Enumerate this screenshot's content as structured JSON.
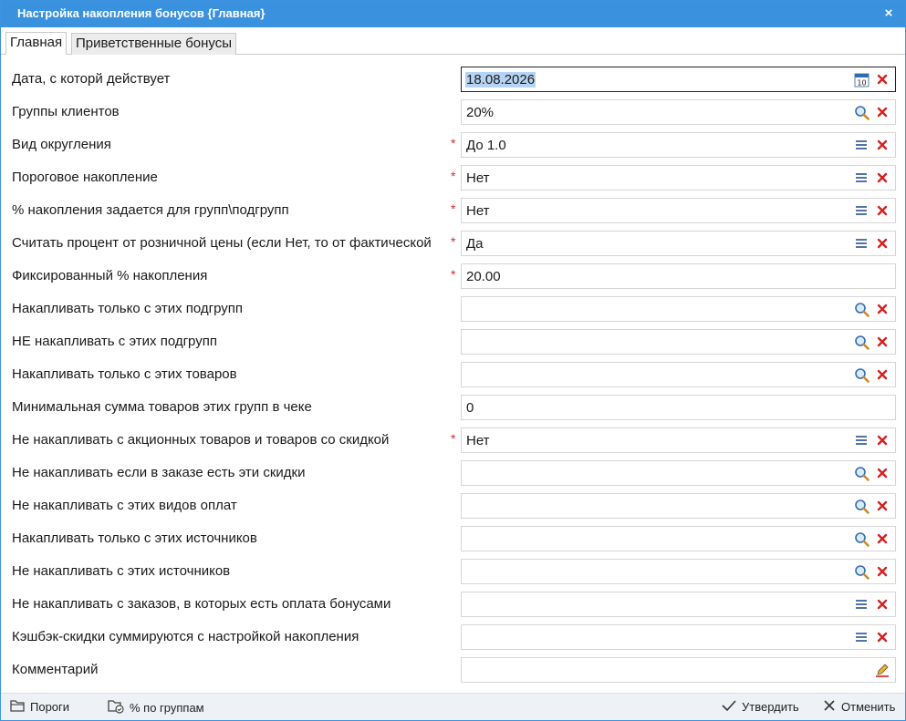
{
  "window": {
    "title": "Настройка накопления бонусов {Главная}",
    "close_label": "×"
  },
  "tabs": [
    {
      "label": "Главная",
      "active": true
    },
    {
      "label": "Приветственные бонусы",
      "active": false
    }
  ],
  "fields": [
    {
      "label": "Дата, с которй действует",
      "value": "18.08.2026",
      "required": false,
      "icons": [
        "calendar-icon",
        "clear-icon"
      ],
      "focused": true
    },
    {
      "label": "Группы клиентов",
      "value": "20%",
      "required": false,
      "icons": [
        "search-icon",
        "clear-icon"
      ]
    },
    {
      "label": "Вид округления",
      "value": "До 1.0",
      "required": true,
      "icons": [
        "list-icon",
        "clear-icon"
      ]
    },
    {
      "label": "Пороговое накопление",
      "value": "Нет",
      "required": true,
      "icons": [
        "list-icon",
        "clear-icon"
      ]
    },
    {
      "label": "% накопления задается для групп\\подгрупп",
      "value": "Нет",
      "required": true,
      "icons": [
        "list-icon",
        "clear-icon"
      ]
    },
    {
      "label": "Считать процент от розничной цены (если Нет, то от фактической",
      "value": "Да",
      "required": true,
      "icons": [
        "list-icon",
        "clear-icon"
      ]
    },
    {
      "label": "Фиксированный % накопления",
      "value": "20.00",
      "required": true,
      "icons": []
    },
    {
      "label": "Накапливать только с этих подгрупп",
      "value": "",
      "required": false,
      "icons": [
        "search-icon",
        "clear-icon"
      ]
    },
    {
      "label": "НЕ накапливать с этих подгрупп",
      "value": "",
      "required": false,
      "icons": [
        "search-icon",
        "clear-icon"
      ]
    },
    {
      "label": "Накапливать только с этих товаров",
      "value": "",
      "required": false,
      "icons": [
        "search-icon",
        "clear-icon"
      ]
    },
    {
      "label": "Минимальная сумма товаров этих групп в чеке",
      "value": "0",
      "required": false,
      "icons": []
    },
    {
      "label": "Не накапливать с акционных товаров и товаров со скидкой",
      "value": "Нет",
      "required": true,
      "icons": [
        "list-icon",
        "clear-icon"
      ]
    },
    {
      "label": "Не накапливать если в заказе есть эти скидки",
      "value": "",
      "required": false,
      "icons": [
        "search-icon",
        "clear-icon"
      ]
    },
    {
      "label": "Не накапливать с этих видов оплат",
      "value": "",
      "required": false,
      "icons": [
        "search-icon",
        "clear-icon"
      ]
    },
    {
      "label": "Накапливать только с этих источников",
      "value": "",
      "required": false,
      "icons": [
        "search-icon",
        "clear-icon"
      ]
    },
    {
      "label": "Не накапливать с этих источников",
      "value": "",
      "required": false,
      "icons": [
        "search-icon",
        "clear-icon"
      ]
    },
    {
      "label": "Не накапливать с заказов, в которых есть оплата бонусами",
      "value": "",
      "required": false,
      "icons": [
        "list-icon",
        "clear-icon"
      ]
    },
    {
      "label": "Кэшбэк-скидки суммируются с настройкой накопления",
      "value": "",
      "required": false,
      "icons": [
        "list-icon",
        "clear-icon"
      ]
    },
    {
      "label": "Комментарий",
      "value": "",
      "required": false,
      "icons": [
        "edit-icon"
      ]
    }
  ],
  "required_mark": "*",
  "calendar_day": "10",
  "footer": {
    "thresholds_label": "Пороги",
    "by_groups_label": "% по группам",
    "approve_label": "Утвердить",
    "cancel_label": "Отменить"
  },
  "colors": {
    "titlebar": "#3a92df",
    "required": "#d12b2b",
    "clear": "#d32121",
    "icon_blue": "#3b6fb6"
  }
}
